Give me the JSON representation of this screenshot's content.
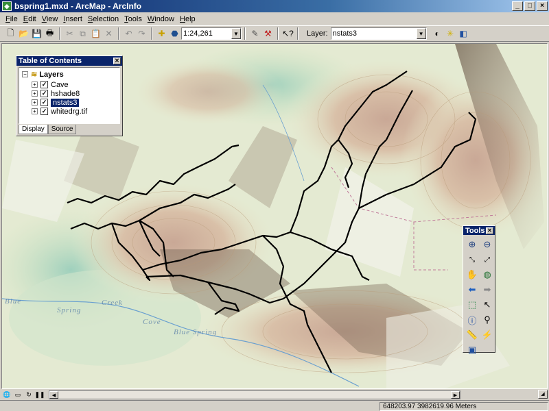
{
  "window": {
    "title": "bspring1.mxd - ArcMap - ArcInfo",
    "controls": [
      "_",
      "□",
      "×"
    ]
  },
  "menu": [
    {
      "label": "File",
      "key": "F",
      "rest": "ile"
    },
    {
      "label": "Edit",
      "key": "E",
      "rest": "dit"
    },
    {
      "label": "View",
      "key": "V",
      "rest": "iew"
    },
    {
      "label": "Insert",
      "key": "I",
      "rest": "nsert"
    },
    {
      "label": "Selection",
      "key": "S",
      "rest": "election"
    },
    {
      "label": "Tools",
      "key": "T",
      "rest": "ools"
    },
    {
      "label": "Window",
      "key": "W",
      "rest": "indow"
    },
    {
      "label": "Help",
      "key": "H",
      "rest": "elp"
    }
  ],
  "toolbar": {
    "scale_value": "1:24,261",
    "layer_label": "Layer:",
    "layer_value": "nstats3"
  },
  "toc": {
    "title": "Table of Contents",
    "root_label": "Layers",
    "layers": [
      {
        "name": "Cave",
        "checked": true,
        "selected": false
      },
      {
        "name": "hshade8",
        "checked": true,
        "selected": false
      },
      {
        "name": "nstats3",
        "checked": true,
        "selected": true
      },
      {
        "name": "whitedrg.tif",
        "checked": true,
        "selected": false
      }
    ],
    "tabs": [
      "Display",
      "Source"
    ]
  },
  "map": {
    "labels": [
      "Blue",
      "Spring",
      "Creek",
      "Cove",
      "Blue Spring"
    ]
  },
  "tools": {
    "title": "Tools",
    "icons": [
      "zoom-in-icon",
      "zoom-out-icon",
      "fixed-zoom-in-icon",
      "fixed-zoom-out-icon",
      "pan-icon",
      "full-extent-icon",
      "back-extent-icon",
      "forward-extent-icon",
      "select-features-icon",
      "select-elements-icon",
      "identify-icon",
      "find-icon",
      "measure-icon",
      "hyperlink-icon",
      "map-tips-icon"
    ]
  },
  "status": {
    "coordinates": "648203.97  3982619.96 Meters"
  }
}
